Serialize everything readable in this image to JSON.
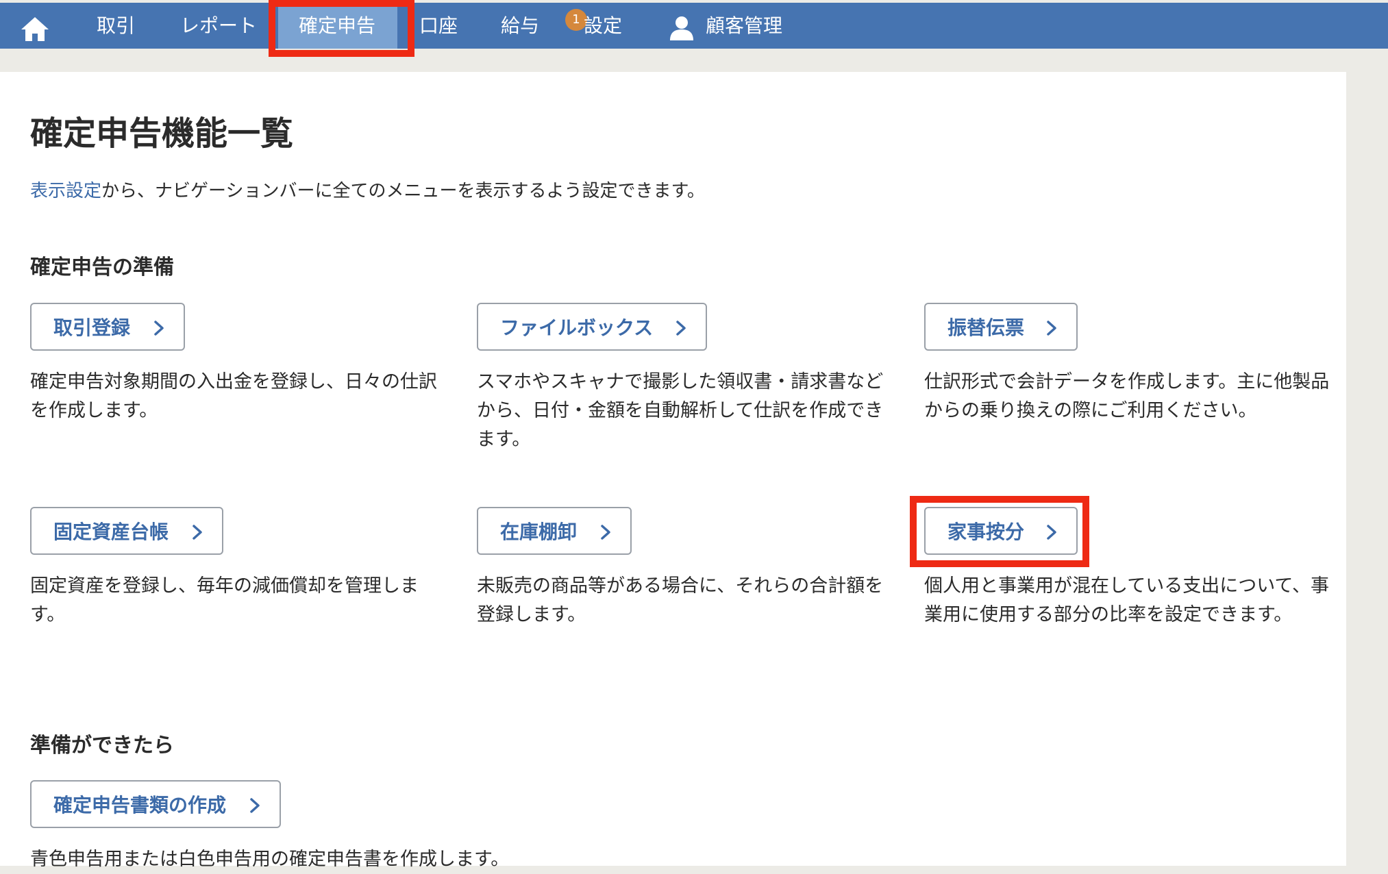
{
  "nav": {
    "home_icon": "home-icon",
    "items": [
      "取引",
      "レポート",
      "確定申告",
      "口座",
      "給与",
      "設定",
      "顧客管理"
    ],
    "active_index": 2,
    "settings_badge": "1",
    "user_icon": "user-icon"
  },
  "page": {
    "title": "確定申告機能一覧",
    "hint_link": "表示設定",
    "hint_text": "から、ナビゲーションバーに全てのメニューを表示するよう設定できます。"
  },
  "sections": [
    {
      "title": "確定申告の準備",
      "cards": [
        {
          "label": "取引登録",
          "description": "確定申告対象期間の入出金を登録し、日々の仕訳を作成します。"
        },
        {
          "label": "ファイルボックス",
          "description": "スマホやスキャナで撮影した領収書・請求書などから、日付・金額を自動解析して仕訳を作成できます。"
        },
        {
          "label": "振替伝票",
          "description": "仕訳形式で会計データを作成します。主に他製品からの乗り換えの際にご利用ください。"
        },
        {
          "label": "固定資産台帳",
          "description": "固定資産を登録し、毎年の減価償却を管理します。"
        },
        {
          "label": "在庫棚卸",
          "description": "未販売の商品等がある場合に、それらの合計額を登録します。"
        },
        {
          "label": "家事按分",
          "description": "個人用と事業用が混在している支出について、事業用に使用する部分の比率を設定できます。"
        }
      ]
    },
    {
      "title": "準備ができたら",
      "cards": [
        {
          "label": "確定申告書類の作成",
          "description": "青色申告用または白色申告用の確定申告書を作成します。"
        }
      ]
    }
  ],
  "colors": {
    "nav_bg": "#4674b1",
    "nav_active": "#7ba3d2",
    "link": "#3c6aa8",
    "badge": "#d5883c",
    "highlight": "#ee2a14"
  }
}
